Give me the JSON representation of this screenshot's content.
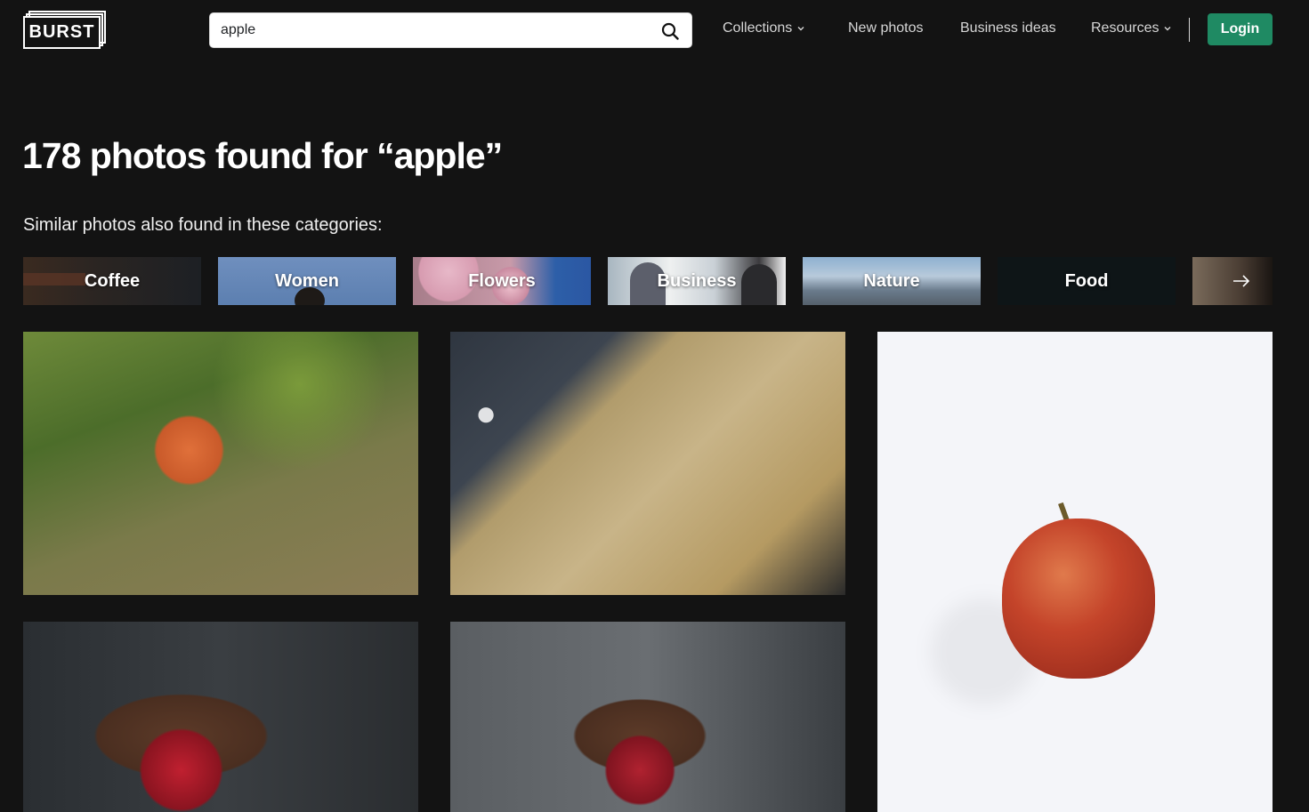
{
  "header": {
    "logo_text": "BURST",
    "search": {
      "value": "apple",
      "placeholder": "Search free stock photos"
    },
    "nav": [
      {
        "label": "Collections",
        "has_dropdown": true
      },
      {
        "label": "New photos",
        "has_dropdown": false
      },
      {
        "label": "Business ideas",
        "has_dropdown": false
      },
      {
        "label": "Resources",
        "has_dropdown": true
      }
    ],
    "login_label": "Login"
  },
  "main": {
    "title": "178 photos found for “apple”",
    "subtitle": "Similar photos also found in these categories:",
    "categories": [
      {
        "label": "Coffee"
      },
      {
        "label": "Women"
      },
      {
        "label": "Flowers"
      },
      {
        "label": "Business"
      },
      {
        "label": "Nature"
      },
      {
        "label": "Food"
      }
    ],
    "categories_next_icon": "arrow-right-icon"
  },
  "colors": {
    "background": "#131313",
    "accent": "#1f8a63",
    "nav_text": "#d6d6d6"
  }
}
